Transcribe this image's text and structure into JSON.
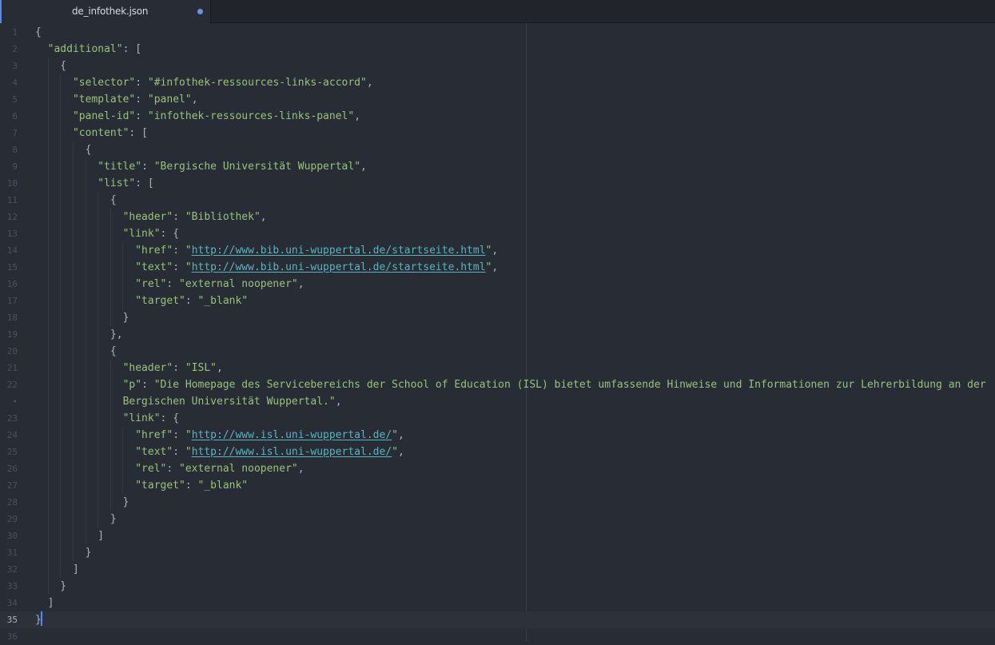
{
  "tab": {
    "title": "de_infothek.json",
    "modified_indicator": "modified-dot"
  },
  "editor": {
    "wrap_marker": "•",
    "lines": [
      {
        "n": "1",
        "segs": [
          [
            "p",
            "{"
          ]
        ]
      },
      {
        "n": "2",
        "segs": [
          [
            "p",
            "  "
          ],
          [
            "k",
            "\"additional\""
          ],
          [
            "p",
            ": ["
          ]
        ]
      },
      {
        "n": "3",
        "segs": [
          [
            "p",
            "    {"
          ]
        ]
      },
      {
        "n": "4",
        "segs": [
          [
            "p",
            "      "
          ],
          [
            "k",
            "\"selector\""
          ],
          [
            "p",
            ": "
          ],
          [
            "s",
            "\"#infothek-ressources-links-accord\""
          ],
          [
            "p",
            ","
          ]
        ]
      },
      {
        "n": "5",
        "segs": [
          [
            "p",
            "      "
          ],
          [
            "k",
            "\"template\""
          ],
          [
            "p",
            ": "
          ],
          [
            "s",
            "\"panel\""
          ],
          [
            "p",
            ","
          ]
        ]
      },
      {
        "n": "6",
        "segs": [
          [
            "p",
            "      "
          ],
          [
            "k",
            "\"panel-id\""
          ],
          [
            "p",
            ": "
          ],
          [
            "s",
            "\"infothek-ressources-links-panel\""
          ],
          [
            "p",
            ","
          ]
        ]
      },
      {
        "n": "7",
        "segs": [
          [
            "p",
            "      "
          ],
          [
            "k",
            "\"content\""
          ],
          [
            "p",
            ": ["
          ]
        ]
      },
      {
        "n": "8",
        "segs": [
          [
            "p",
            "        {"
          ]
        ]
      },
      {
        "n": "9",
        "segs": [
          [
            "p",
            "          "
          ],
          [
            "k",
            "\"title\""
          ],
          [
            "p",
            ": "
          ],
          [
            "s",
            "\"Bergische Universität Wuppertal\""
          ],
          [
            "p",
            ","
          ]
        ]
      },
      {
        "n": "10",
        "segs": [
          [
            "p",
            "          "
          ],
          [
            "k",
            "\"list\""
          ],
          [
            "p",
            ": ["
          ]
        ]
      },
      {
        "n": "11",
        "segs": [
          [
            "p",
            "            {"
          ]
        ]
      },
      {
        "n": "12",
        "segs": [
          [
            "p",
            "              "
          ],
          [
            "k",
            "\"header\""
          ],
          [
            "p",
            ": "
          ],
          [
            "s",
            "\"Bibliothek\""
          ],
          [
            "p",
            ","
          ]
        ]
      },
      {
        "n": "13",
        "segs": [
          [
            "p",
            "              "
          ],
          [
            "k",
            "\"link\""
          ],
          [
            "p",
            ": {"
          ]
        ]
      },
      {
        "n": "14",
        "segs": [
          [
            "p",
            "                "
          ],
          [
            "k",
            "\"href\""
          ],
          [
            "p",
            ": "
          ],
          [
            "s",
            "\""
          ],
          [
            "u",
            "http://www.bib.uni-wuppertal.de/startseite.html"
          ],
          [
            "s",
            "\""
          ],
          [
            "p",
            ","
          ]
        ]
      },
      {
        "n": "15",
        "segs": [
          [
            "p",
            "                "
          ],
          [
            "k",
            "\"text\""
          ],
          [
            "p",
            ": "
          ],
          [
            "s",
            "\""
          ],
          [
            "u",
            "http://www.bib.uni-wuppertal.de/startseite.html"
          ],
          [
            "s",
            "\""
          ],
          [
            "p",
            ","
          ]
        ]
      },
      {
        "n": "16",
        "segs": [
          [
            "p",
            "                "
          ],
          [
            "k",
            "\"rel\""
          ],
          [
            "p",
            ": "
          ],
          [
            "s",
            "\"external noopener\""
          ],
          [
            "p",
            ","
          ]
        ]
      },
      {
        "n": "17",
        "segs": [
          [
            "p",
            "                "
          ],
          [
            "k",
            "\"target\""
          ],
          [
            "p",
            ": "
          ],
          [
            "s",
            "\"_blank\""
          ]
        ]
      },
      {
        "n": "18",
        "segs": [
          [
            "p",
            "              }"
          ]
        ]
      },
      {
        "n": "19",
        "segs": [
          [
            "p",
            "            },"
          ]
        ]
      },
      {
        "n": "20",
        "segs": [
          [
            "p",
            "            {"
          ]
        ]
      },
      {
        "n": "21",
        "segs": [
          [
            "p",
            "              "
          ],
          [
            "k",
            "\"header\""
          ],
          [
            "p",
            ": "
          ],
          [
            "s",
            "\"ISL\""
          ],
          [
            "p",
            ","
          ]
        ]
      },
      {
        "n": "22",
        "segs": [
          [
            "p",
            "              "
          ],
          [
            "k",
            "\"p\""
          ],
          [
            "p",
            ": "
          ],
          [
            "s",
            "\"Die Homepage des Servicebereichs der School of Education (ISL) bietet umfassende Hinweise und Informationen zur Lehrerbildung an der"
          ]
        ]
      },
      {
        "n": "•",
        "segs": [
          [
            "p",
            "              "
          ],
          [
            "s",
            "Bergischen Universität Wuppertal.\""
          ],
          [
            "p",
            ","
          ]
        ]
      },
      {
        "n": "23",
        "segs": [
          [
            "p",
            "              "
          ],
          [
            "k",
            "\"link\""
          ],
          [
            "p",
            ": {"
          ]
        ]
      },
      {
        "n": "24",
        "segs": [
          [
            "p",
            "                "
          ],
          [
            "k",
            "\"href\""
          ],
          [
            "p",
            ": "
          ],
          [
            "s",
            "\""
          ],
          [
            "u",
            "http://www.isl.uni-wuppertal.de/"
          ],
          [
            "s",
            "\""
          ],
          [
            "p",
            ","
          ]
        ]
      },
      {
        "n": "25",
        "segs": [
          [
            "p",
            "                "
          ],
          [
            "k",
            "\"text\""
          ],
          [
            "p",
            ": "
          ],
          [
            "s",
            "\""
          ],
          [
            "u",
            "http://www.isl.uni-wuppertal.de/"
          ],
          [
            "s",
            "\""
          ],
          [
            "p",
            ","
          ]
        ]
      },
      {
        "n": "26",
        "segs": [
          [
            "p",
            "                "
          ],
          [
            "k",
            "\"rel\""
          ],
          [
            "p",
            ": "
          ],
          [
            "s",
            "\"external noopener\""
          ],
          [
            "p",
            ","
          ]
        ]
      },
      {
        "n": "27",
        "segs": [
          [
            "p",
            "                "
          ],
          [
            "k",
            "\"target\""
          ],
          [
            "p",
            ": "
          ],
          [
            "s",
            "\"_blank\""
          ]
        ]
      },
      {
        "n": "28",
        "segs": [
          [
            "p",
            "              }"
          ]
        ]
      },
      {
        "n": "29",
        "segs": [
          [
            "p",
            "            }"
          ]
        ]
      },
      {
        "n": "30",
        "segs": [
          [
            "p",
            "          ]"
          ]
        ]
      },
      {
        "n": "31",
        "segs": [
          [
            "p",
            "        }"
          ]
        ]
      },
      {
        "n": "32",
        "segs": [
          [
            "p",
            "      ]"
          ]
        ]
      },
      {
        "n": "33",
        "segs": [
          [
            "p",
            "    }"
          ]
        ]
      },
      {
        "n": "34",
        "segs": [
          [
            "p",
            "  ]"
          ]
        ]
      },
      {
        "n": "35",
        "segs": [
          [
            "p",
            "}"
          ]
        ],
        "cursor": true
      },
      {
        "n": "36",
        "segs": []
      }
    ]
  }
}
